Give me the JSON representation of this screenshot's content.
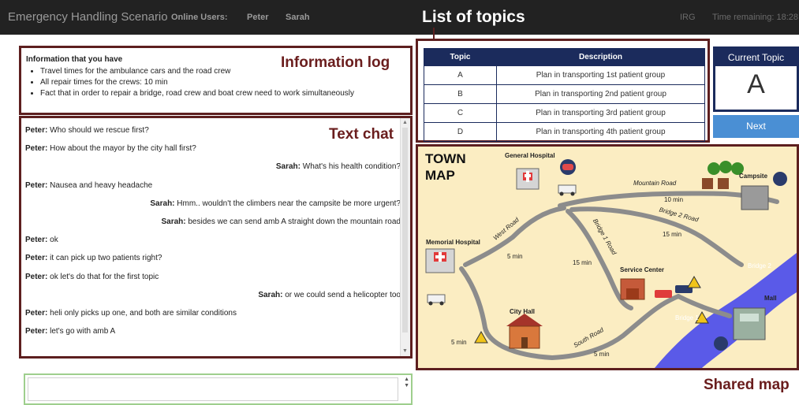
{
  "header": {
    "app_title": "Emergency Handling Scenario",
    "online_label": "Online Users:",
    "online_users": [
      "Peter",
      "Sarah"
    ],
    "org": "IRG",
    "time_remaining": "Time remaining: 18:28"
  },
  "annotations": {
    "topics": "List of topics",
    "info_log": "Information log",
    "text_chat": "Text chat",
    "shared_map": "Shared map"
  },
  "info_log": {
    "title": "Information that you have",
    "items": [
      "Travel times for the ambulance cars and the road crew",
      "All repair times for the crews: 10 min",
      "Fact that in order to repair a bridge, road crew and boat crew need to work simultaneously"
    ]
  },
  "chat": {
    "messages": [
      {
        "speaker": "Peter:",
        "text": "Who should we rescue first?",
        "align": "left"
      },
      {
        "speaker": "Peter:",
        "text": "How about the mayor by the city hall first?",
        "align": "left"
      },
      {
        "speaker": "Sarah:",
        "text": "What's his health condition?",
        "align": "right"
      },
      {
        "speaker": "Peter:",
        "text": "Nausea and heavy headache",
        "align": "left"
      },
      {
        "speaker": "Sarah:",
        "text": "Hmm.. wouldn't the climbers near the campsite be more urgent?",
        "align": "right"
      },
      {
        "speaker": "Sarah:",
        "text": "besides we can send amb A straight down the mountain road",
        "align": "right"
      },
      {
        "speaker": "Peter:",
        "text": "ok",
        "align": "left"
      },
      {
        "speaker": "Peter:",
        "text": "it can pick up two patients right?",
        "align": "left"
      },
      {
        "speaker": "Peter:",
        "text": "ok let's do that for the first topic",
        "align": "left"
      },
      {
        "speaker": "Sarah:",
        "text": "or we could send a helicopter too",
        "align": "right"
      },
      {
        "speaker": "Peter:",
        "text": "heli only picks up one, and both are similar conditions",
        "align": "left"
      },
      {
        "speaker": "Peter:",
        "text": "let's go with amb A",
        "align": "left"
      }
    ]
  },
  "chat_input": {
    "value": "",
    "placeholder": ""
  },
  "topics": {
    "headers": [
      "Topic",
      "Description"
    ],
    "rows": [
      {
        "topic": "A",
        "description": "Plan in transporting 1st patient group"
      },
      {
        "topic": "B",
        "description": "Plan in transporting 2nd patient group"
      },
      {
        "topic": "C",
        "description": "Plan in transporting 3rd patient group"
      },
      {
        "topic": "D",
        "description": "Plan in transporting 4th patient group"
      }
    ]
  },
  "current_topic": {
    "title": "Current Topic",
    "value": "A",
    "next_label": "Next"
  },
  "map": {
    "title_line1": "TOWN",
    "title_line2": "MAP",
    "places": {
      "general_hospital": "General Hospital",
      "campsite": "Campsite",
      "memorial_hospital": "Memorial Hospital",
      "service_center": "Service Center",
      "city_hall": "City Hall",
      "mall": "Mall",
      "bridge1": "Bridge 1",
      "bridge2": "Bridge 2"
    },
    "roads": {
      "mountain": "Mountain Road",
      "west": "West Road",
      "bridge1_road": "Bridge 1 Road",
      "bridge2_road": "Bridge 2 Road",
      "south": "South Road"
    },
    "times": {
      "t_10min": "10 min",
      "t_15min_a": "15 min",
      "t_15min_b": "15 min",
      "t_5min_a": "5 min",
      "t_5min_b": "5 min",
      "t_5min_c": "5 min"
    },
    "colors": {
      "ground": "#fbedc2",
      "road": "#8c8c8c",
      "river": "#5a5ae8"
    }
  }
}
